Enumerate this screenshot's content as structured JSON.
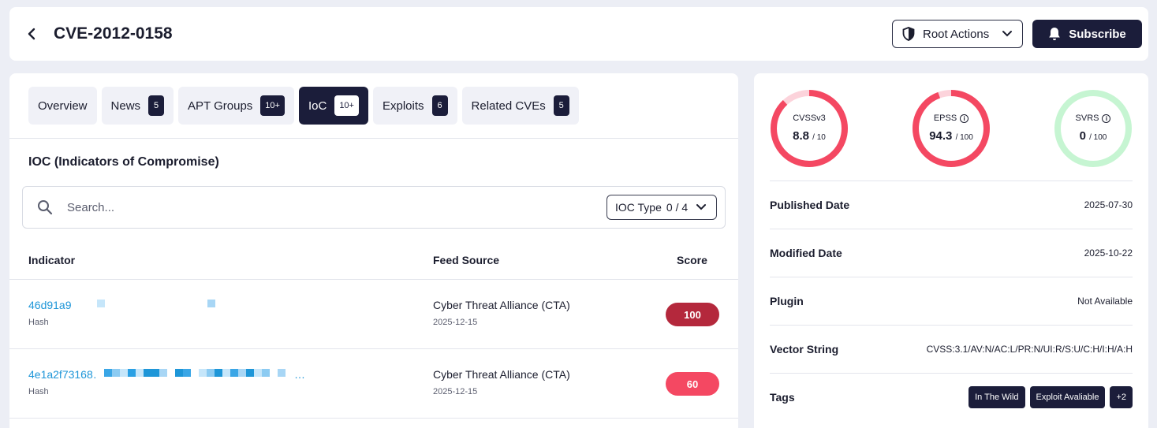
{
  "header": {
    "title": "CVE-2012-0158",
    "root_actions_label": "Root Actions",
    "subscribe_label": "Subscribe"
  },
  "tabs": [
    {
      "label": "Overview",
      "badge": ""
    },
    {
      "label": "News",
      "badge": "5"
    },
    {
      "label": "APT Groups",
      "badge": "10+"
    },
    {
      "label": "IoC",
      "badge": "10+",
      "active": true
    },
    {
      "label": "Exploits",
      "badge": "6"
    },
    {
      "label": "Related CVEs",
      "badge": "5"
    }
  ],
  "ioc": {
    "section_title": "IOC (Indicators of Compromise)",
    "search_placeholder": "Search...",
    "type_filter_label": "IOC Type",
    "type_filter_count": "0 / 4",
    "columns": {
      "indicator": "Indicator",
      "feed": "Feed Source",
      "score": "Score"
    },
    "rows": [
      {
        "indicator": "46d91a9",
        "type": "Hash",
        "feed": "Cyber Threat Alliance (CTA)",
        "date": "2025-12-15",
        "score": "100",
        "score_color": "#b4283c"
      },
      {
        "indicator": "4e1a2f73168…",
        "type": "Hash",
        "feed": "Cyber Threat Alliance (CTA)",
        "date": "2025-12-15",
        "score": "60",
        "score_color": "#f44862"
      }
    ]
  },
  "scores": [
    {
      "label": "CVSSv3",
      "value": "8.8",
      "max": "/ 10",
      "fraction": 0.88,
      "info": false,
      "color": "#f44862",
      "track": "#fcd3db"
    },
    {
      "label": "EPSS",
      "value": "94.3",
      "max": "/ 100",
      "fraction": 0.943,
      "info": true,
      "color": "#f44862",
      "track": "#fcd3db"
    },
    {
      "label": "SVRS",
      "value": "0",
      "max": "/ 100",
      "fraction": 0,
      "info": true,
      "color": "#f44862",
      "track": "#c6f5d2"
    }
  ],
  "details": {
    "published_label": "Published Date",
    "published_value": "2025-07-30",
    "modified_label": "Modified Date",
    "modified_value": "2025-10-22",
    "plugin_label": "Plugin",
    "plugin_value": "Not Available",
    "vector_label": "Vector String",
    "vector_value": "CVSS:3.1/AV:N/AC:L/PR:N/UI:R/S:U/C:H/I:H/A:H",
    "tags_label": "Tags",
    "tags": [
      "In The Wild",
      "Exploit Avaliable",
      "+2"
    ]
  },
  "colors": {
    "accent": "#1b1d3a",
    "link": "#1e96d8",
    "danger": "#f44862"
  }
}
